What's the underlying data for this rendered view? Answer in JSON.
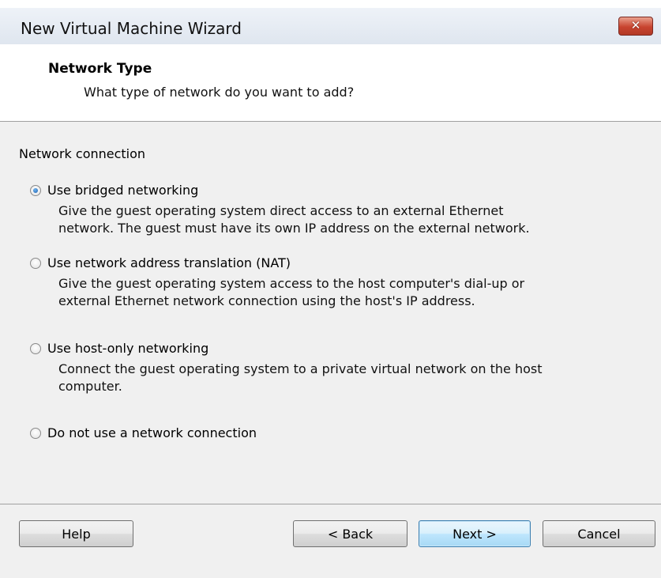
{
  "window": {
    "title": "New Virtual Machine Wizard",
    "close_symbol": "✕",
    "close_icon": "close-icon"
  },
  "header": {
    "title": "Network Type",
    "subtitle": "What type of network do you want to add?"
  },
  "group_label": "Network connection",
  "options": [
    {
      "label": "Use bridged networking",
      "selected": true,
      "description": [
        "Give the guest operating system direct access to an external Ethernet",
        "network. The guest must have its own IP address on the external network."
      ]
    },
    {
      "label": "Use network address translation (NAT)",
      "selected": false,
      "description": [
        "Give the guest operating system access to the host computer's dial-up or",
        "external Ethernet network connection using the host's IP address."
      ]
    },
    {
      "label": "Use host-only networking",
      "selected": false,
      "description": [
        "Connect the guest operating system to a private virtual network on the host",
        "computer."
      ]
    },
    {
      "label": "Do not use a network connection",
      "selected": false,
      "description": []
    }
  ],
  "buttons": {
    "help": "Help",
    "back": "< Back",
    "next": "Next >",
    "cancel": "Cancel"
  },
  "colors": {
    "close_button": "#c8442f",
    "default_button_border": "#3c7fb1",
    "radio_selected": "#1c5fae"
  }
}
